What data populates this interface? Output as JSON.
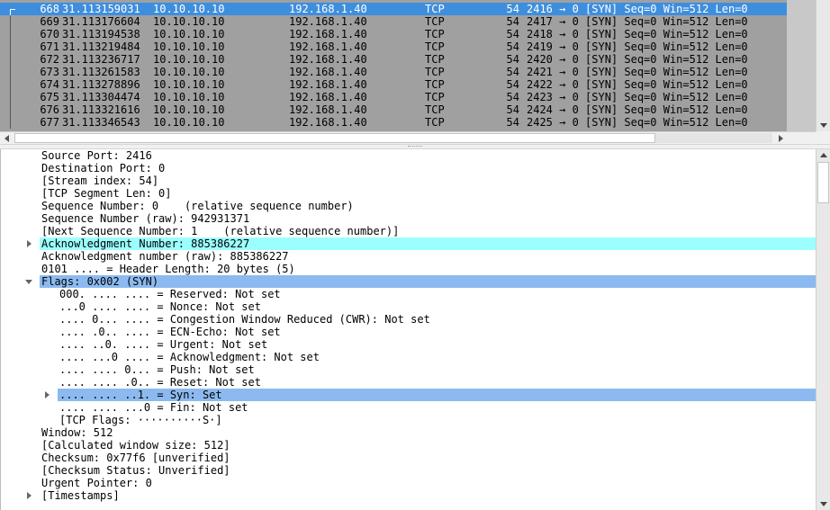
{
  "packet_list": {
    "rows": [
      {
        "no": "668",
        "time": "31.113159031",
        "src": "10.10.10.10",
        "dst": "192.168.1.40",
        "proto": "TCP",
        "len": "54",
        "info": "2416 → 0 [SYN] Seq=0 Win=512 Len=0",
        "selected": true
      },
      {
        "no": "669",
        "time": "31.113176604",
        "src": "10.10.10.10",
        "dst": "192.168.1.40",
        "proto": "TCP",
        "len": "54",
        "info": "2417 → 0 [SYN] Seq=0 Win=512 Len=0"
      },
      {
        "no": "670",
        "time": "31.113194538",
        "src": "10.10.10.10",
        "dst": "192.168.1.40",
        "proto": "TCP",
        "len": "54",
        "info": "2418 → 0 [SYN] Seq=0 Win=512 Len=0"
      },
      {
        "no": "671",
        "time": "31.113219484",
        "src": "10.10.10.10",
        "dst": "192.168.1.40",
        "proto": "TCP",
        "len": "54",
        "info": "2419 → 0 [SYN] Seq=0 Win=512 Len=0"
      },
      {
        "no": "672",
        "time": "31.113236717",
        "src": "10.10.10.10",
        "dst": "192.168.1.40",
        "proto": "TCP",
        "len": "54",
        "info": "2420 → 0 [SYN] Seq=0 Win=512 Len=0"
      },
      {
        "no": "673",
        "time": "31.113261583",
        "src": "10.10.10.10",
        "dst": "192.168.1.40",
        "proto": "TCP",
        "len": "54",
        "info": "2421 → 0 [SYN] Seq=0 Win=512 Len=0"
      },
      {
        "no": "674",
        "time": "31.113278896",
        "src": "10.10.10.10",
        "dst": "192.168.1.40",
        "proto": "TCP",
        "len": "54",
        "info": "2422 → 0 [SYN] Seq=0 Win=512 Len=0"
      },
      {
        "no": "675",
        "time": "31.113304474",
        "src": "10.10.10.10",
        "dst": "192.168.1.40",
        "proto": "TCP",
        "len": "54",
        "info": "2423 → 0 [SYN] Seq=0 Win=512 Len=0"
      },
      {
        "no": "676",
        "time": "31.113321616",
        "src": "10.10.10.10",
        "dst": "192.168.1.40",
        "proto": "TCP",
        "len": "54",
        "info": "2424 → 0 [SYN] Seq=0 Win=512 Len=0"
      },
      {
        "no": "677",
        "time": "31.113346543",
        "src": "10.10.10.10",
        "dst": "192.168.1.40",
        "proto": "TCP",
        "len": "54",
        "info": "2425 → 0 [SYN] Seq=0 Win=512 Len=0"
      }
    ],
    "colors": {
      "row_bg": "#a0a0a0",
      "selected_bg": "#3e8ede",
      "selected_fg": "#ffffff"
    }
  },
  "details": {
    "rows": [
      {
        "text": "Source Port: 2416",
        "indent": 1
      },
      {
        "text": "Destination Port: 0",
        "indent": 1
      },
      {
        "text": "[Stream index: 54]",
        "indent": 1
      },
      {
        "text": "[TCP Segment Len: 0]",
        "indent": 1
      },
      {
        "text": "Sequence Number: 0    (relative sequence number)",
        "indent": 1
      },
      {
        "text": "Sequence Number (raw): 942931371",
        "indent": 1
      },
      {
        "text": "[Next Sequence Number: 1    (relative sequence number)]",
        "indent": 1
      },
      {
        "text": "Acknowledgment Number: 885386227",
        "indent": 1,
        "expander": "closed",
        "highlight": "cyan"
      },
      {
        "text": "Acknowledgment number (raw): 885386227",
        "indent": 1
      },
      {
        "text": "0101 .... = Header Length: 20 bytes (5)",
        "indent": 1
      },
      {
        "text": "Flags: 0x002 (SYN)",
        "indent": 1,
        "expander": "open",
        "highlight": "blue"
      },
      {
        "text": "000. .... .... = Reserved: Not set",
        "indent": 2
      },
      {
        "text": "...0 .... .... = Nonce: Not set",
        "indent": 2
      },
      {
        "text": ".... 0... .... = Congestion Window Reduced (CWR): Not set",
        "indent": 2
      },
      {
        "text": ".... .0.. .... = ECN-Echo: Not set",
        "indent": 2
      },
      {
        "text": ".... ..0. .... = Urgent: Not set",
        "indent": 2
      },
      {
        "text": ".... ...0 .... = Acknowledgment: Not set",
        "indent": 2
      },
      {
        "text": ".... .... 0... = Push: Not set",
        "indent": 2
      },
      {
        "text": ".... .... .0.. = Reset: Not set",
        "indent": 2
      },
      {
        "text": ".... .... ..1. = Syn: Set",
        "indent": 2,
        "expander": "closed",
        "highlight": "blue"
      },
      {
        "text": ".... .... ...0 = Fin: Not set",
        "indent": 2
      },
      {
        "text": "[TCP Flags: ··········S·]",
        "indent": 2
      },
      {
        "text": "Window: 512",
        "indent": 1
      },
      {
        "text": "[Calculated window size: 512]",
        "indent": 1
      },
      {
        "text": "Checksum: 0x77f6 [unverified]",
        "indent": 1
      },
      {
        "text": "[Checksum Status: Unverified]",
        "indent": 1
      },
      {
        "text": "Urgent Pointer: 0",
        "indent": 1
      },
      {
        "text": "[Timestamps]",
        "indent": 1,
        "expander": "closed"
      }
    ],
    "colors": {
      "cyan": "#9cffff",
      "blue": "#8cbaf0"
    }
  },
  "icons": {
    "expand": "triangle-right-icon",
    "collapse": "triangle-down-icon",
    "scroll_up": "arrow-up-icon",
    "scroll_down": "arrow-down-icon",
    "scroll_left": "arrow-left-icon",
    "scroll_right": "arrow-right-icon"
  }
}
